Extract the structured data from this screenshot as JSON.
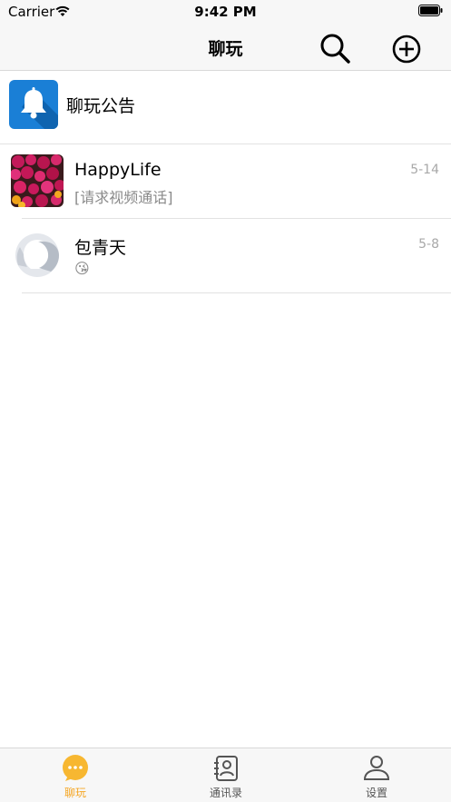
{
  "status_bar": {
    "carrier": "Carrier",
    "time": "9:42 PM"
  },
  "nav": {
    "title": "聊玩",
    "search_icon": "search-icon",
    "add_icon": "add-circle-icon"
  },
  "notice": {
    "label": "聊玩公告",
    "icon": "bell-icon"
  },
  "chats": [
    {
      "name": "HappyLife",
      "preview": "[请求视频通话]",
      "time": "5-14",
      "avatar": "flowers-photo"
    },
    {
      "name": "包青天",
      "preview": "😘",
      "time": "5-8",
      "avatar": "default-person"
    }
  ],
  "tabs": [
    {
      "label": "聊玩",
      "icon": "chat-bubble-icon",
      "active": true
    },
    {
      "label": "通讯录",
      "icon": "contacts-book-icon",
      "active": false
    },
    {
      "label": "设置",
      "icon": "person-icon",
      "active": false
    }
  ],
  "colors": {
    "accent": "#f5a623",
    "notice_blue": "#1a7fd6",
    "bar_bg": "#f7f7f7",
    "muted_text": "#8a8a8a"
  }
}
